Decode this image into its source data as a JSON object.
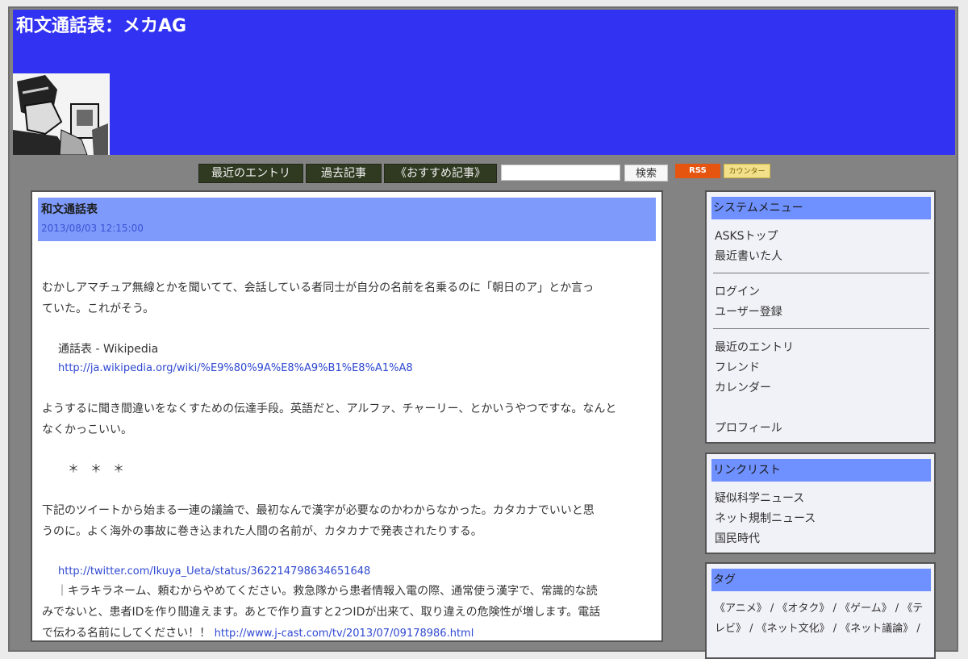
{
  "site": {
    "title": "和文通話表：メカAG"
  },
  "nav": {
    "recent": "最近のエントリ",
    "archive": "過去記事",
    "recommended": "《おすすめ記事》",
    "search_button": "検索",
    "search_placeholder": "",
    "badge_rss": "RSS",
    "badge_counter": "カウンター"
  },
  "entry": {
    "title": "和文通話表",
    "date": "2013/08/03 12:15:00",
    "p1_line1": "むかしアマチュア無線とかを聞いてて、会話している者同士が自分の名前を名乗るのに「朝日のア」とか言っ",
    "p1_line2": "ていた。これがそう。",
    "ref1_label": "通話表 - Wikipedia",
    "ref1_url": "http://ja.wikipedia.org/wiki/%E9%80%9A%E8%A9%B1%E8%A1%A8",
    "p2_line1": "ようするに聞き間違いをなくすための伝達手段。英語だと、アルファ、チャーリー、とかいうやつですな。なんと",
    "p2_line2": "なくかっこいい。",
    "separator": "＊　＊　＊",
    "p3_line1": "下記のツイートから始まる一連の議論で、最初なんで漢字が必要なのかわからなかった。カタカナでいいと思",
    "p3_line2": "うのに。よく海外の事故に巻き込まれた人間の名前が、カタカナで発表されたりする。",
    "tweet_url": "http://twitter.com/Ikuya_Ueta/status/362214798634651648",
    "quote_line1": "｜キラキラネーム、頼むからやめてください。救急隊から患者情報入電の際、通常使う漢字で、常識的な読",
    "quote_line2": "みでないと、患者IDを作り間違えます。あとで作り直すと2つIDが出来て、取り違えの危険性が増します。電話",
    "quote_line3": "で伝わる名前にしてください！！",
    "quote_url": "http://www.j-cast.com/tv/2013/07/09178986.html"
  },
  "sidebar": {
    "system": {
      "heading": "システムメニュー",
      "items": [
        "ASKSトップ",
        "最近書いた人",
        "ログイン",
        "ユーザー登録",
        "最近のエントリ",
        "フレンド",
        "カレンダー",
        "プロフィール"
      ]
    },
    "links": {
      "heading": "リンクリスト",
      "items": [
        "疑似科学ニュース",
        "ネット規制ニュース",
        "国民時代"
      ]
    },
    "tags": {
      "heading": "タグ",
      "line1": "《アニメ》 / 《オタク》 / 《ゲーム》 / 《テ",
      "line2": "レビ》 / 《ネット文化》 / 《ネット議論》 /"
    }
  }
}
